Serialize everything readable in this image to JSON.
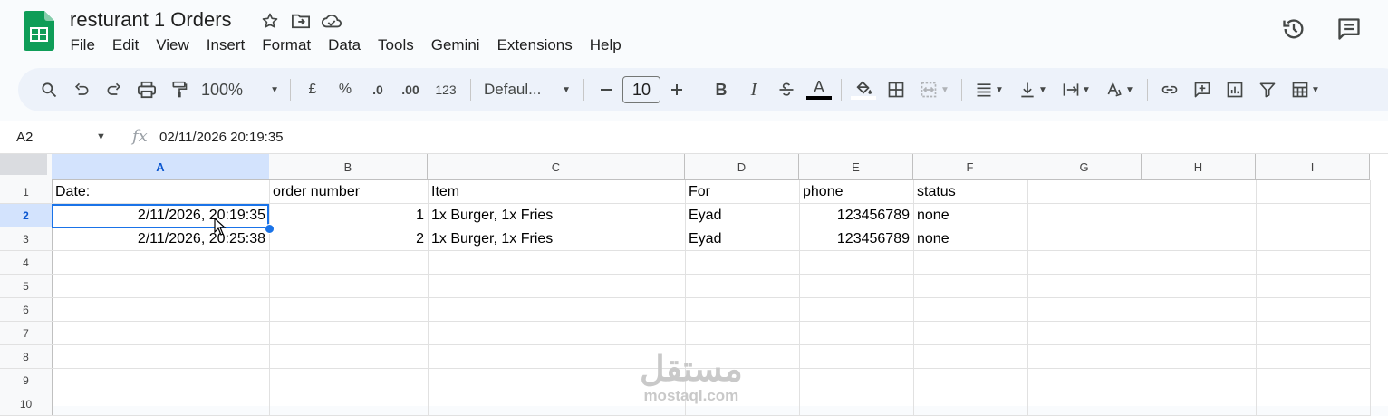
{
  "app": {
    "title": "resturant 1 Orders",
    "menu": [
      "File",
      "Edit",
      "View",
      "Insert",
      "Format",
      "Data",
      "Tools",
      "Gemini",
      "Extensions",
      "Help"
    ]
  },
  "toolbar": {
    "zoom": "100%",
    "currency": "£",
    "percent": "%",
    "dec_decrease": ".0",
    "dec_increase": ".00",
    "number_format": "123",
    "font": "Defaul...",
    "font_size": "10",
    "bold": "B",
    "italic": "I",
    "text_color_letter": "A"
  },
  "formula_bar": {
    "name_box": "A2",
    "fx": "fx",
    "value": "02/11/2026 20:19:35"
  },
  "sheet": {
    "columns": [
      "A",
      "B",
      "C",
      "D",
      "E",
      "F",
      "G",
      "H",
      "I"
    ],
    "rows": [
      "1",
      "2",
      "3",
      "4",
      "5",
      "6",
      "7",
      "8",
      "9",
      "10"
    ],
    "selected_cell": "A2",
    "cells": [
      [
        "Date:",
        "order number",
        "Item",
        "For",
        "phone",
        "status",
        "",
        "",
        ""
      ],
      [
        "2/11/2026, 20:19:35",
        "1",
        "1x Burger, 1x Fries",
        "Eyad",
        "123456789",
        "none",
        "",
        "",
        ""
      ],
      [
        "2/11/2026, 20:25:38",
        "2",
        "1x Burger, 1x Fries",
        "Eyad",
        "123456789",
        "none",
        "",
        "",
        ""
      ]
    ]
  },
  "watermark": {
    "arabic": "مستقل",
    "latin": "mostaql.com"
  },
  "colors": {
    "accent": "#1a73e8",
    "selected_header": "#d3e3fd",
    "toolbar_bg": "#edf2fa",
    "sheets_green": "#0f9d58"
  }
}
